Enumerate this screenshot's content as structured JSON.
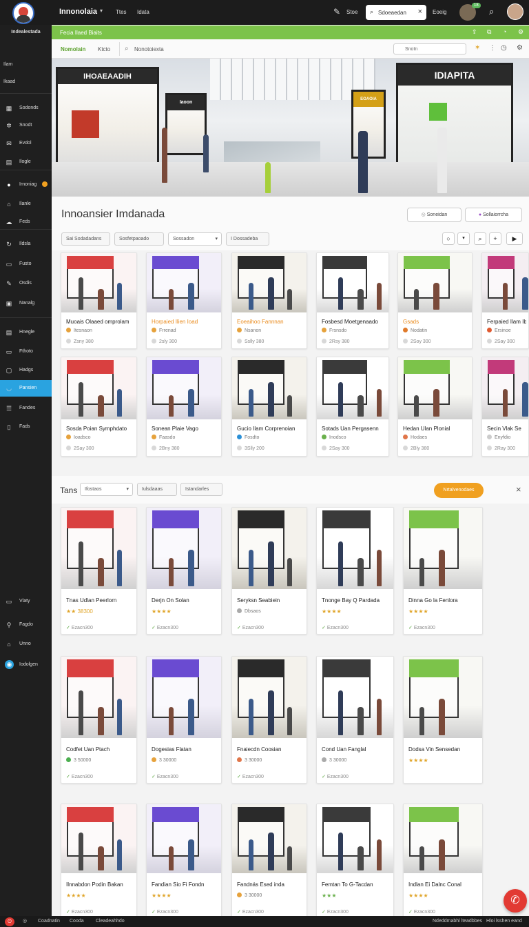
{
  "app": {
    "title": "Innonolaia",
    "brand": "Indealestada",
    "links": [
      "Ttes",
      "Idata"
    ],
    "search_label": "Stoe",
    "search_value": "Sdoeaedan",
    "right_label": "Eoeig",
    "badge": "18"
  },
  "sidebar": {
    "items": [
      {
        "label": "Ilam",
        "icon": ""
      },
      {
        "label": "Ikaad",
        "icon": ""
      },
      {
        "label": "Sodonds",
        "icon": "grid-icon"
      },
      {
        "label": "Snodt",
        "icon": "gear-icon"
      },
      {
        "label": "Evdol",
        "icon": "mail-icon"
      },
      {
        "label": "Ilogle",
        "icon": "doc-icon"
      },
      {
        "label": "Irnoniag",
        "icon": "info-icon"
      },
      {
        "label": "Ilanle",
        "icon": "home-icon"
      },
      {
        "label": "Feds",
        "icon": "cloud-icon"
      },
      {
        "label": "Ildsla",
        "icon": "refresh-icon"
      },
      {
        "label": "Fusto",
        "icon": "image-icon"
      },
      {
        "label": "Osdis",
        "icon": "tag-icon"
      },
      {
        "label": "Nanalg",
        "icon": "box-icon"
      },
      {
        "label": "Hnegle",
        "icon": "inbox-icon"
      },
      {
        "label": "Fthoto",
        "icon": "image-icon"
      },
      {
        "label": "Hadgs",
        "icon": "frame-icon"
      },
      {
        "label": "Pansien",
        "icon": "cup-icon"
      },
      {
        "label": "Fandes",
        "icon": "list-icon"
      },
      {
        "label": "Fads",
        "icon": "page-icon"
      },
      {
        "label": "Vlaty",
        "icon": "monitor-icon"
      },
      {
        "label": "Fagdo",
        "icon": "pin-icon"
      },
      {
        "label": "Unno",
        "icon": "lock-icon"
      },
      {
        "label": "Iodolgen",
        "icon": "user-icon"
      }
    ]
  },
  "greenbar": {
    "title": "Fecia Ilaed Biaits"
  },
  "subbar": {
    "tabs": [
      "Nomolain",
      "Ktcto"
    ],
    "search": "Nonotoiexta",
    "filter": "Snotn"
  },
  "hero": {
    "signs": [
      "IHOAEAADIH",
      "Iaoon",
      "EOAOIA",
      "IDIAPITA"
    ]
  },
  "main": {
    "title": "Innoansier Imdanada",
    "btn1": "Soneidan",
    "btn2": "Sollaiorrcha",
    "chips": [
      "Sai Sodadadans",
      "Sosfetpaoado",
      "Sossadon",
      "I Dossadeba"
    ]
  },
  "grid1": [
    {
      "title": "Muoais Olaaed omprolam",
      "meta": "Itesnaon",
      "info": "Zsny 380",
      "color": "#e6a23c"
    },
    {
      "title": "Horpaied Ilien Ioad",
      "meta": "Frrenad",
      "info": "2sly 300",
      "color": "#e6a23c",
      "title_color": "#e98b1e"
    },
    {
      "title": "Eoeaihoo Fannnan",
      "meta": "Nsanon",
      "info": "Sslly 380",
      "color": "#e6a23c",
      "title_color": "#e98b1e"
    },
    {
      "title": "Fosbesd Moetgenaado",
      "meta": "Frsnsdo",
      "info": "2Rsy 380",
      "color": "#e6a23c"
    },
    {
      "title": "Gsads",
      "meta": "Nodatin",
      "info": "2Soy 300",
      "color": "#e07a2a",
      "title_color": "#e98b1e"
    },
    {
      "title": "Ferpaied Ilam Ib",
      "meta": "Ersinoe",
      "info": "2Say 300",
      "color": "#e05a30"
    }
  ],
  "grid2": [
    {
      "title": "Sosda Poian Symphdato",
      "meta": "Ioadsco",
      "info": "2Say 300",
      "color": "#e6a23c"
    },
    {
      "title": "Sonean Plaie Vago",
      "meta": "Faasdo",
      "info": "2Bny 380",
      "color": "#e6a23c"
    },
    {
      "title": "Gucio Ilam Corprenoian",
      "meta": "Fosdto",
      "info": "3Slly 200",
      "color": "#2a8fd6"
    },
    {
      "title": "Sotads Uan Pergasenn",
      "meta": "Inodsco",
      "info": "2Say 300",
      "color": "#6ab04c"
    },
    {
      "title": "Hedan Ulan Plonial",
      "meta": "Hodaes",
      "info": "2Bly 380",
      "color": "#e0764a"
    },
    {
      "title": "Secin Vlak Se",
      "meta": "Enyfdio",
      "info": "2Ray 300",
      "color": "#cccccc"
    }
  ],
  "sec2": {
    "title": "Tans",
    "select": "Ifostaos",
    "chip1": "Iulsdaaas",
    "chip2": "Istandarles",
    "button": "Nrtalvenodaes"
  },
  "grid3": [
    {
      "title": "Tnas Udlan Peerlorn",
      "rating": "★★ 38300",
      "footer": "Ezacn300",
      "type": "stars"
    },
    {
      "title": "Derjn On Solan",
      "rating": "★★★★",
      "footer": "Ezacn300",
      "type": "stars"
    },
    {
      "title": "Seryksn Seabiein",
      "rating": "Dbsaos",
      "footer": "Ezacn300",
      "type": "dot",
      "color": "#aaaaaa"
    },
    {
      "title": "Tnonge Bay Q Pardada",
      "rating": "★★★★",
      "footer": "Ezacn300",
      "type": "stars"
    },
    {
      "title": "Dinna Go la Fenlora",
      "rating": "★★★★",
      "footer": "Ezacn300",
      "type": "stars"
    }
  ],
  "grid4": [
    {
      "title": "Codfet Uan Ptach",
      "rating": "3 50000",
      "footer": "Ezacn300",
      "type": "dot",
      "color": "#4caf50"
    },
    {
      "title": "Dogesias Flatan",
      "rating": "3 30000",
      "footer": "Ezacn300",
      "type": "dot",
      "color": "#e6a23c"
    },
    {
      "title": "Fnaiecdn Coosian",
      "rating": "3 30000",
      "footer": "Ezacn300",
      "type": "dot",
      "color": "#e0764a"
    },
    {
      "title": "Cond Uan Fanglal",
      "rating": "3 30000",
      "footer": "Ezacn300",
      "type": "dot",
      "color": "#aaaaaa"
    },
    {
      "title": "Dodsa Vin Sensedan",
      "rating": "★★★★",
      "footer": "",
      "type": "stars"
    }
  ],
  "grid5": [
    {
      "title": "Ilnnabdon Podin Bakan",
      "rating": "★★★★",
      "footer": "Ezacn300",
      "type": "stars"
    },
    {
      "title": "Fandian Sio Fi Fondn",
      "rating": "★★★★",
      "footer": "Ezacn300",
      "type": "stars"
    },
    {
      "title": "Fandnás Esed inda",
      "rating": "3 30000",
      "footer": "Ezacn300",
      "type": "dot",
      "color": "#e6a23c"
    },
    {
      "title": "Femtan To G-Tacdan",
      "rating": "★★★",
      "footer": "Ezacn300",
      "type": "stars_green"
    },
    {
      "title": "Indlan Ei Dalnc Conal",
      "rating": "★★★★",
      "footer": "Ezacn300",
      "type": "stars"
    }
  ],
  "status": {
    "left1": "Coadnatin",
    "left2": "Cooda",
    "left3": "Cleadeahhdo",
    "right1": "Ndeddmabhl lteadbbes",
    "right2": "Hloi lsshen eand"
  }
}
